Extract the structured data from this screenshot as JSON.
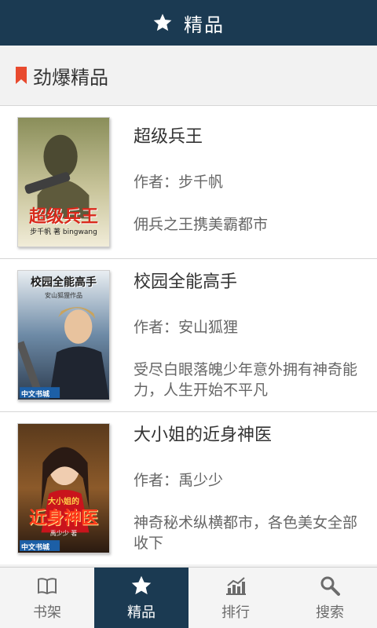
{
  "header": {
    "title": "精品",
    "icon": "star-icon"
  },
  "section": {
    "title": "劲爆精品",
    "accent": "#e84a2e"
  },
  "books": [
    {
      "title": "超级兵王",
      "author": "作者：步千帆",
      "desc": "佣兵之王携美霸都市",
      "cover_text": "超级兵王",
      "cover_sub": "步千帆 著 bingwang"
    },
    {
      "title": "校园全能高手",
      "author": "作者：安山狐狸",
      "desc": "受尽白眼落魄少年意外拥有神奇能力，人生开始不平凡",
      "cover_text": "校园全能高手",
      "cover_sub": "安山狐狸作品",
      "cover_brand": "中文书城"
    },
    {
      "title": "大小姐的近身神医",
      "author": "作者：禹少少",
      "desc": "神奇秘术纵横都市，各色美女全部收下",
      "cover_text": "近身神医",
      "cover_top": "大小姐的",
      "cover_sub": "禹少少 著",
      "cover_brand": "中文书城"
    }
  ],
  "nav": {
    "tabs": [
      {
        "label": "书架",
        "icon": "book-icon",
        "active": false
      },
      {
        "label": "精品",
        "icon": "star-icon",
        "active": true
      },
      {
        "label": "排行",
        "icon": "chart-icon",
        "active": false
      },
      {
        "label": "搜索",
        "icon": "search-icon",
        "active": false
      }
    ]
  },
  "colors": {
    "primary": "#1b3a52",
    "background": "#f2f2f2"
  }
}
